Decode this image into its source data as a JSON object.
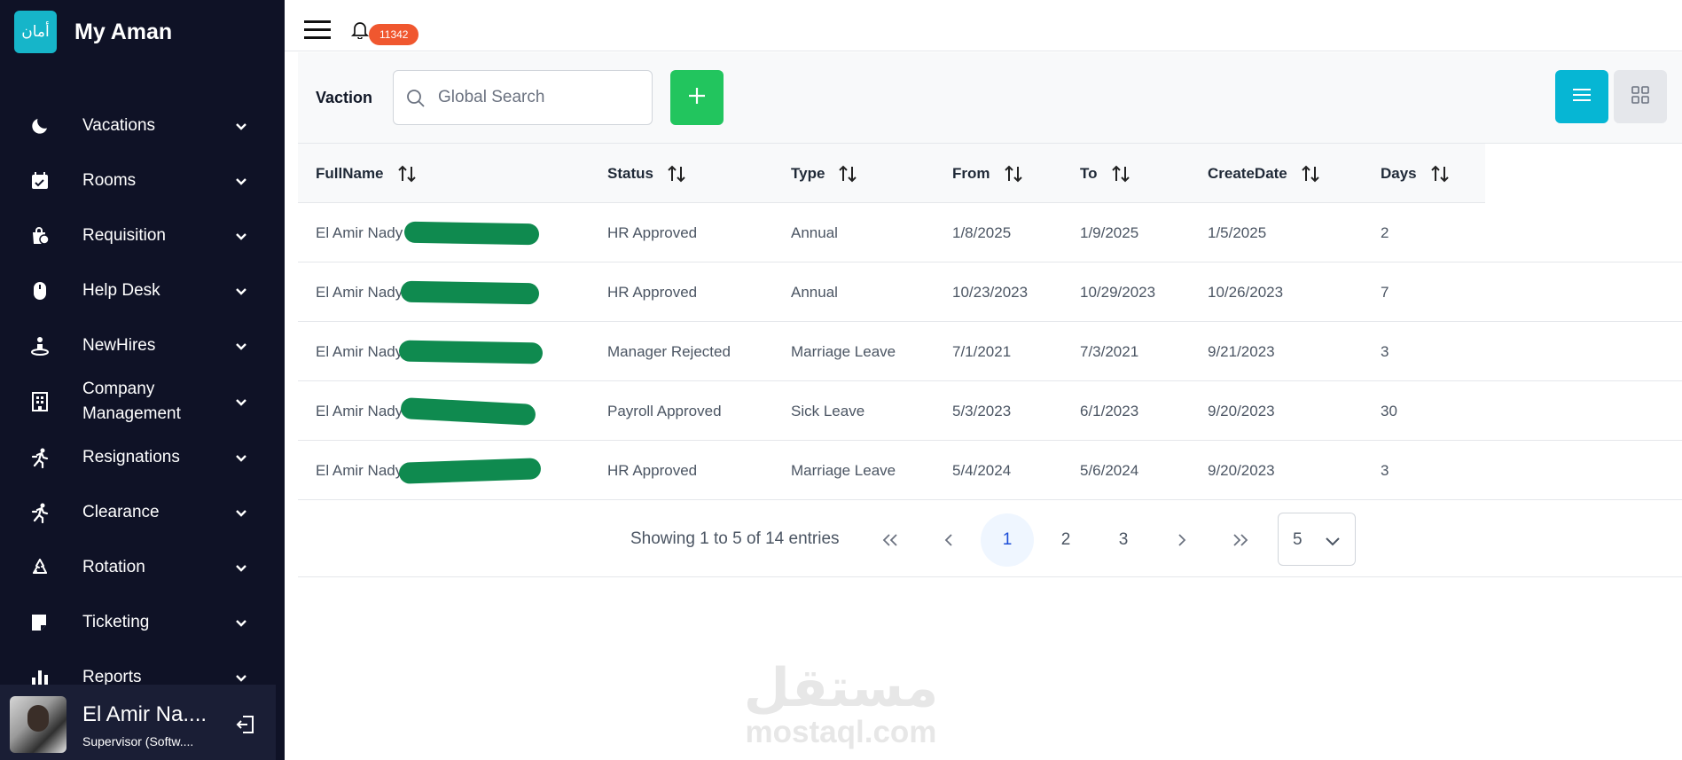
{
  "brand": {
    "logo_text": "أمان",
    "name": "My Aman"
  },
  "sidebar": {
    "items": [
      {
        "label": "Vacations",
        "icon": "moon-icon"
      },
      {
        "label": "Rooms",
        "icon": "calendar-check-icon"
      },
      {
        "label": "Requisition",
        "icon": "shopping-bag-icon"
      },
      {
        "label": "Help Desk",
        "icon": "mouse-icon"
      },
      {
        "label": "NewHires",
        "icon": "person-icon"
      },
      {
        "label": "Company Management",
        "icon": "building-icon"
      },
      {
        "label": "Resignations",
        "icon": "running-icon"
      },
      {
        "label": "Clearance",
        "icon": "running-icon"
      },
      {
        "label": "Rotation",
        "icon": "recycle-icon"
      },
      {
        "label": "Ticketing",
        "icon": "ticket-icon"
      },
      {
        "label": "Reports",
        "icon": "bar-chart-icon"
      }
    ]
  },
  "user": {
    "name": "El Amir Na....",
    "role": "Supervisor (Softw...."
  },
  "topbar": {
    "notification_count": "11342"
  },
  "toolbar": {
    "title": "Vaction",
    "search_placeholder": "Global Search"
  },
  "table": {
    "columns": [
      "FullName",
      "Status",
      "Type",
      "From",
      "To",
      "CreateDate",
      "Days"
    ],
    "rows": [
      {
        "fullname": "El Amir Nady Boulos Lo",
        "status": "HR Approved",
        "type": "Annual",
        "from": "1/8/2025",
        "to": "1/9/2025",
        "created": "1/5/2025",
        "days": "2"
      },
      {
        "fullname": "El Amir Nady",
        "status": "HR Approved",
        "type": "Annual",
        "from": "10/23/2023",
        "to": "10/29/2023",
        "created": "10/26/2023",
        "days": "7"
      },
      {
        "fullname": "El Amir Nady",
        "status": "Manager Rejected",
        "type": "Marriage Leave",
        "from": "7/1/2021",
        "to": "7/3/2021",
        "created": "9/21/2023",
        "days": "3"
      },
      {
        "fullname": "El Amir Nady",
        "status": "Payroll Approved",
        "type": "Sick Leave",
        "from": "5/3/2023",
        "to": "6/1/2023",
        "created": "9/20/2023",
        "days": "30"
      },
      {
        "fullname": "El Amir Nady",
        "status": "HR Approved",
        "type": "Marriage Leave",
        "from": "5/4/2024",
        "to": "5/6/2024",
        "created": "9/20/2023",
        "days": "3"
      }
    ]
  },
  "pager": {
    "report": "Showing 1 to 5 of 14 entries",
    "pages": [
      "1",
      "2",
      "3"
    ],
    "current_page": "1",
    "rows_per_page": "5"
  },
  "watermark": {
    "arabic": "مستقل",
    "latin": "mostaql.com"
  },
  "colors": {
    "sidebar": "#0f1226",
    "accent": "#06b6d4",
    "add": "#22c55e",
    "badge": "#f0572f",
    "redaction": "#0f8a4f"
  }
}
